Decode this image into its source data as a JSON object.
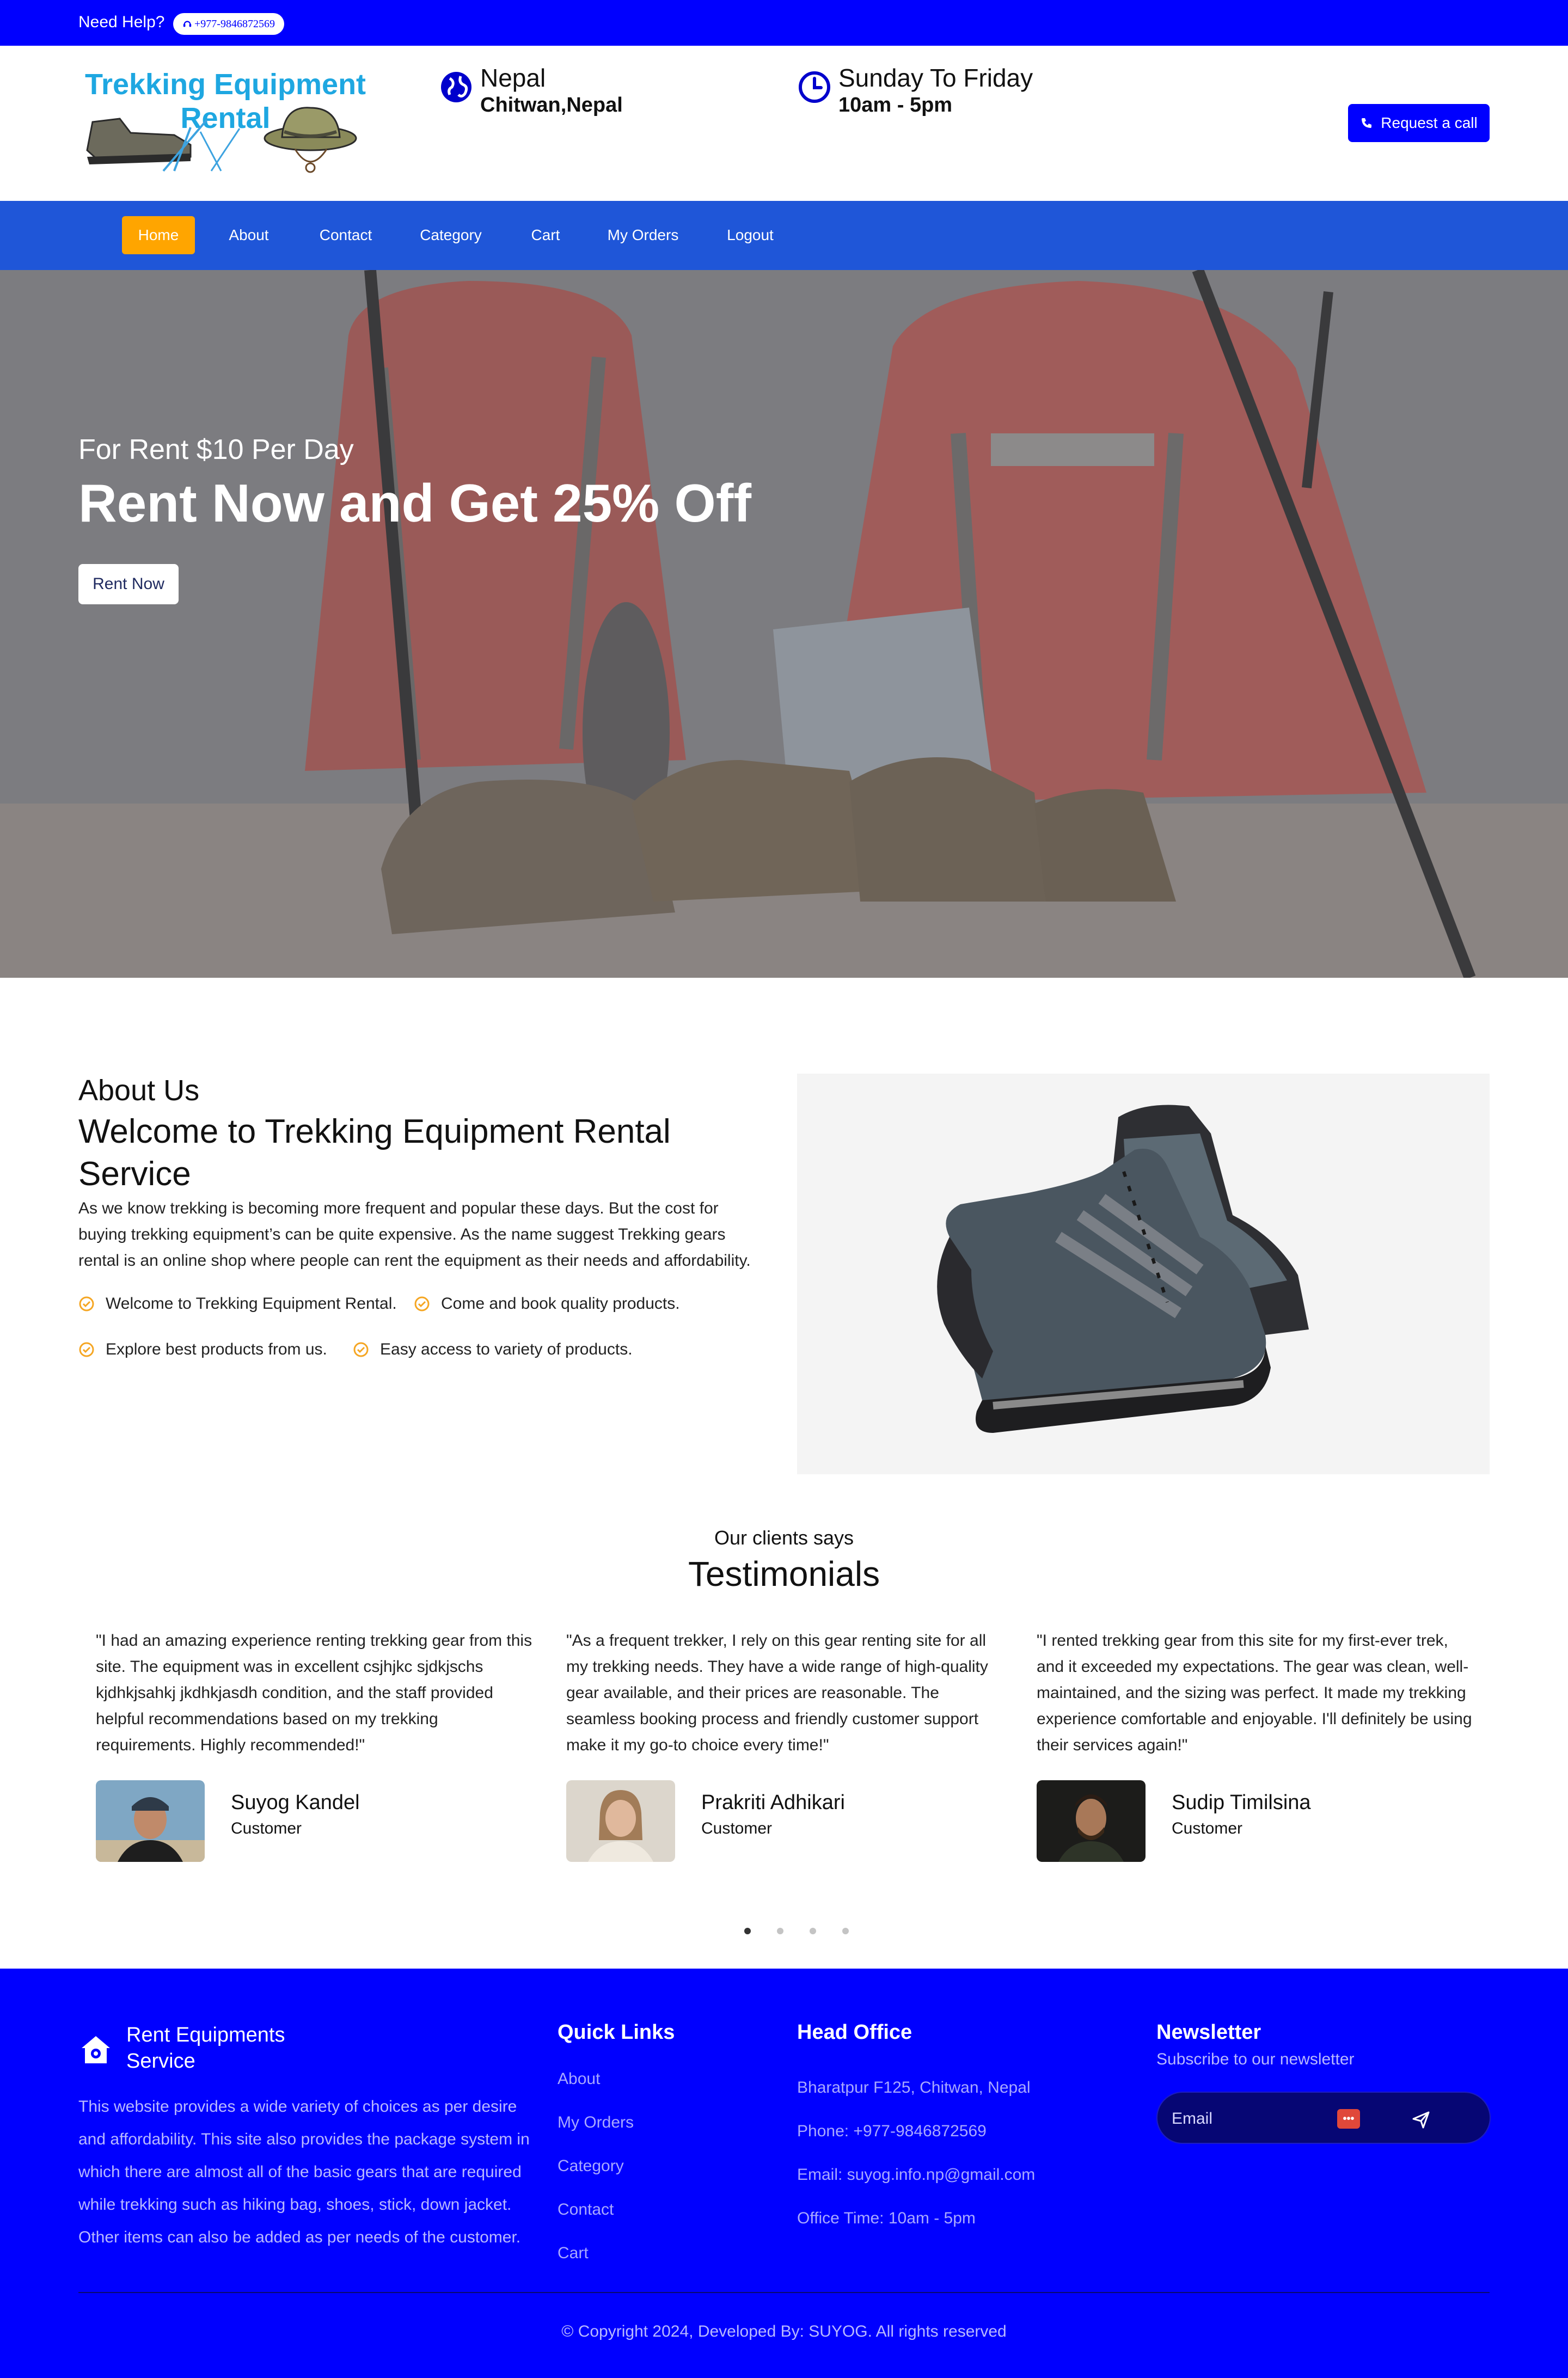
{
  "topbar": {
    "help_label": "Need Help?",
    "phone": "+977-9846872569"
  },
  "header": {
    "logo_text_line1": "Trekking Equipment",
    "logo_text_line2": "Rental",
    "location": {
      "title": "Nepal",
      "subtitle": "Chitwan,Nepal",
      "icon": "globe-icon"
    },
    "hours": {
      "title": "Sunday To Friday",
      "subtitle": "10am - 5pm",
      "icon": "clock-icon"
    },
    "request_button": "Request a call"
  },
  "nav": {
    "items": [
      {
        "label": "Home",
        "active": true
      },
      {
        "label": "About"
      },
      {
        "label": "Contact"
      },
      {
        "label": "Category"
      },
      {
        "label": "Cart"
      },
      {
        "label": "My Orders"
      },
      {
        "label": "Logout"
      }
    ]
  },
  "hero": {
    "subtitle": "For Rent $10 Per Day",
    "title": "Rent Now and Get 25% Off",
    "button": "Rent Now"
  },
  "about": {
    "label": "About Us",
    "title": "Welcome to Trekking Equipment Rental Service",
    "description": "As we know trekking is becoming more frequent and popular these days. But the cost for buying trekking equipment’s can be quite expensive. As the name suggest Trekking gears rental is an online shop where people can rent the equipment as their needs and affordability.",
    "features": [
      "Welcome to Trekking Equipment Rental.",
      "Come and book quality products.",
      "Explore best products from us.",
      "Easy access to variety of products."
    ]
  },
  "testimonials": {
    "subtitle": "Our clients says",
    "title": "Testimonials",
    "items": [
      {
        "quote": "\"I had an amazing experience renting trekking gear from this site. The equipment was in excellent csjhjkc sjdkjschs kjdhkjsahkj jkdhkjasdh condition, and the staff provided helpful recommendations based on my trekking requirements. Highly recommended!\"",
        "name": "Suyog Kandel",
        "role": "Customer"
      },
      {
        "quote": "\"As a frequent trekker, I rely on this gear renting site for all my trekking needs. They have a wide range of high-quality gear available, and their prices are reasonable. The seamless booking process and friendly customer support make it my go-to choice every time!\"",
        "name": "Prakriti Adhikari",
        "role": "Customer"
      },
      {
        "quote": "\"I rented trekking gear from this site for my first-ever trek, and it exceeded my expectations. The gear was clean, well-maintained, and the sizing was perfect. It made my trekking experience comfortable and enjoyable. I'll definitely be using their services again!\"",
        "name": "Sudip Timilsina",
        "role": "Customer"
      }
    ],
    "carousel_pages": 4,
    "carousel_active": 1
  },
  "footer": {
    "brand": "Rent Equipments Service",
    "description": "This website provides a wide variety of choices as per desire and affordability. This site also provides the package system in which there are almost all of the basic gears that are required while trekking such as hiking bag, shoes, stick, down jacket. Other items can also be added as per needs of the customer.",
    "quick_links_title": "Quick Links",
    "quick_links": [
      "About",
      "My Orders",
      "Category",
      "Contact",
      "Cart"
    ],
    "office_title": "Head Office",
    "office_lines": [
      "Bharatpur F125, Chitwan, Nepal",
      "Phone: +977-9846872569",
      "Email: suyog.info.np@gmail.com",
      "Office Time: 10am - 5pm"
    ],
    "newsletter_title": "Newsletter",
    "newsletter_subtitle": "Subscribe to our newsletter",
    "email_placeholder": "Email",
    "copyright": "© Copyright 2024, Developed By: SUYOG. All rights reserved"
  },
  "colors": {
    "primary_blue": "#0000ff",
    "nav_blue": "#1f56d8",
    "accent_orange": "#ffa500",
    "logo_cyan": "#1ea7e1"
  }
}
